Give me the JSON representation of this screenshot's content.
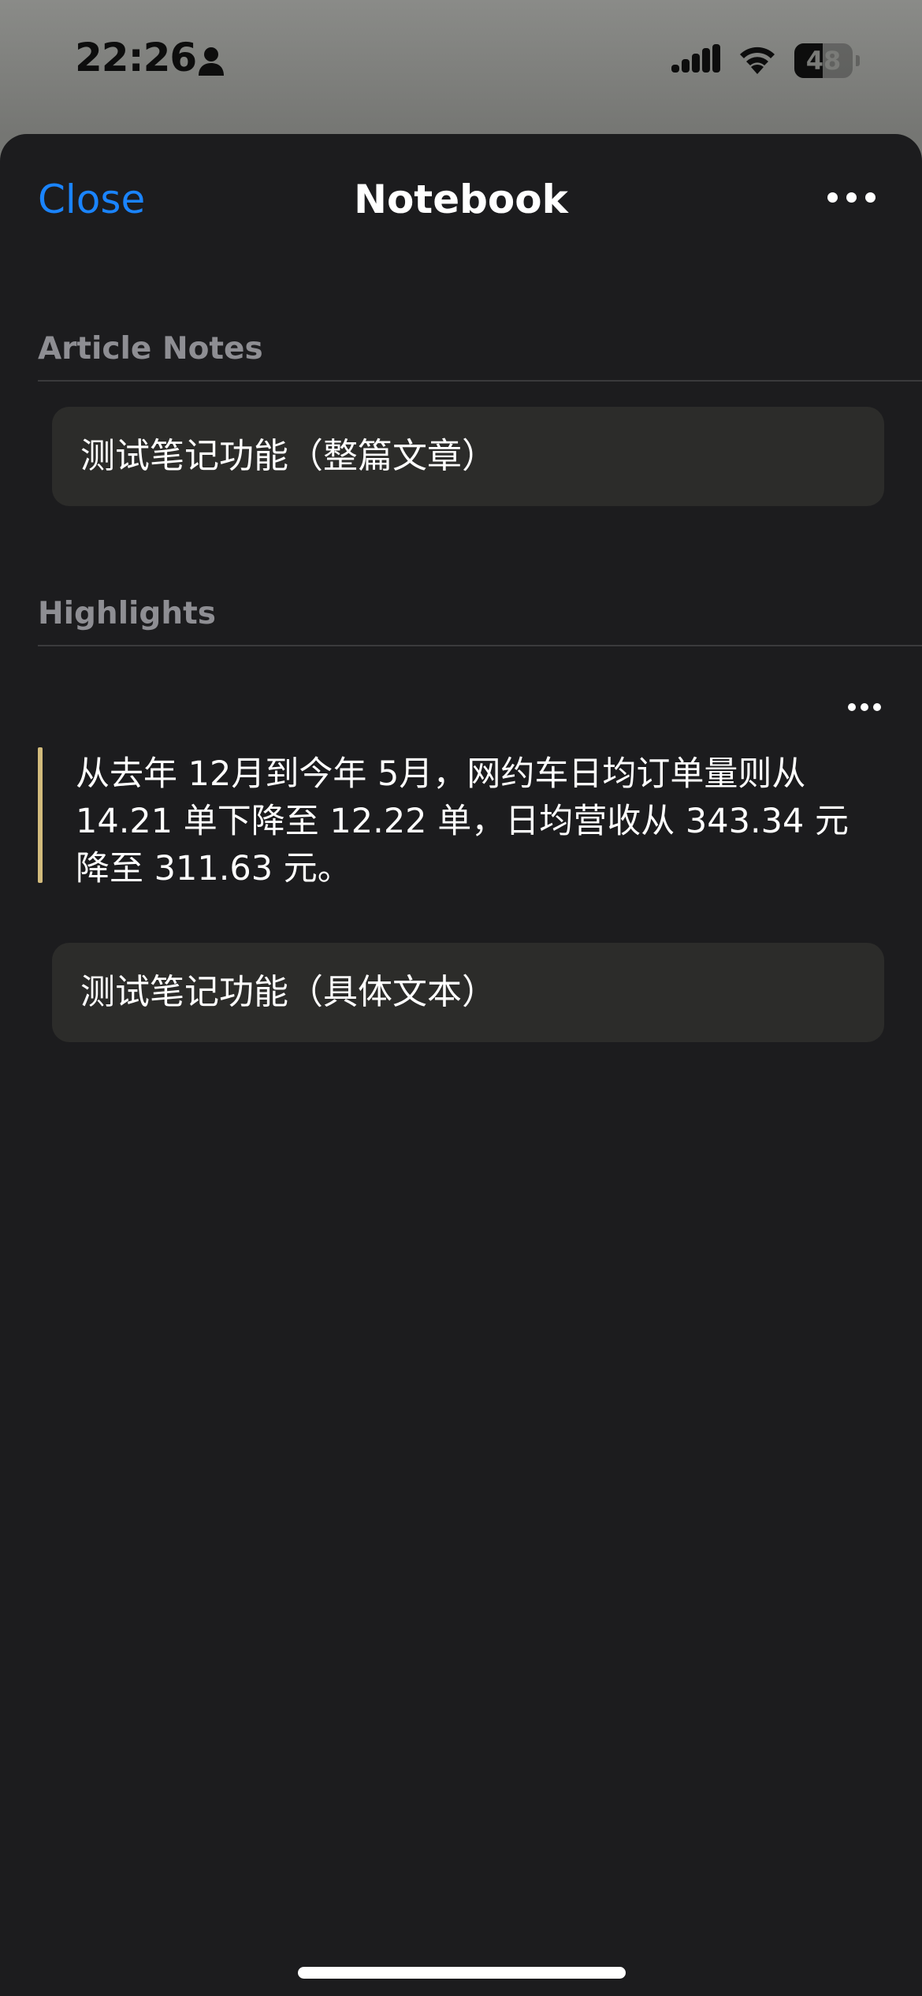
{
  "status_bar": {
    "time": "22:26",
    "battery_level": "48",
    "icons": [
      "person-icon",
      "cellular-signal-icon",
      "wifi-icon",
      "battery-icon"
    ]
  },
  "nav": {
    "close_label": "Close",
    "title": "Notebook",
    "more_icon": "ellipsis-icon"
  },
  "article_notes": {
    "header": "Article Notes",
    "items": [
      {
        "text": "测试笔记功能（整篇文章）"
      }
    ]
  },
  "highlights": {
    "header": "Highlights",
    "more_icon": "ellipsis-icon",
    "items": [
      {
        "quote": "从去年 12月到今年 5月，网约车日均订单量则从 14.21 单下降至 12.22 单，日均营收从 343.34 元降至 311.63 元。",
        "highlight_color": "#d2bb7c",
        "note": "测试笔记功能（具体文本）"
      }
    ]
  },
  "colors": {
    "accent": "#1a84ff",
    "sheet_background": "#1c1c1e",
    "card_background": "#2c2c2a",
    "secondary_text": "#8e8e93"
  }
}
